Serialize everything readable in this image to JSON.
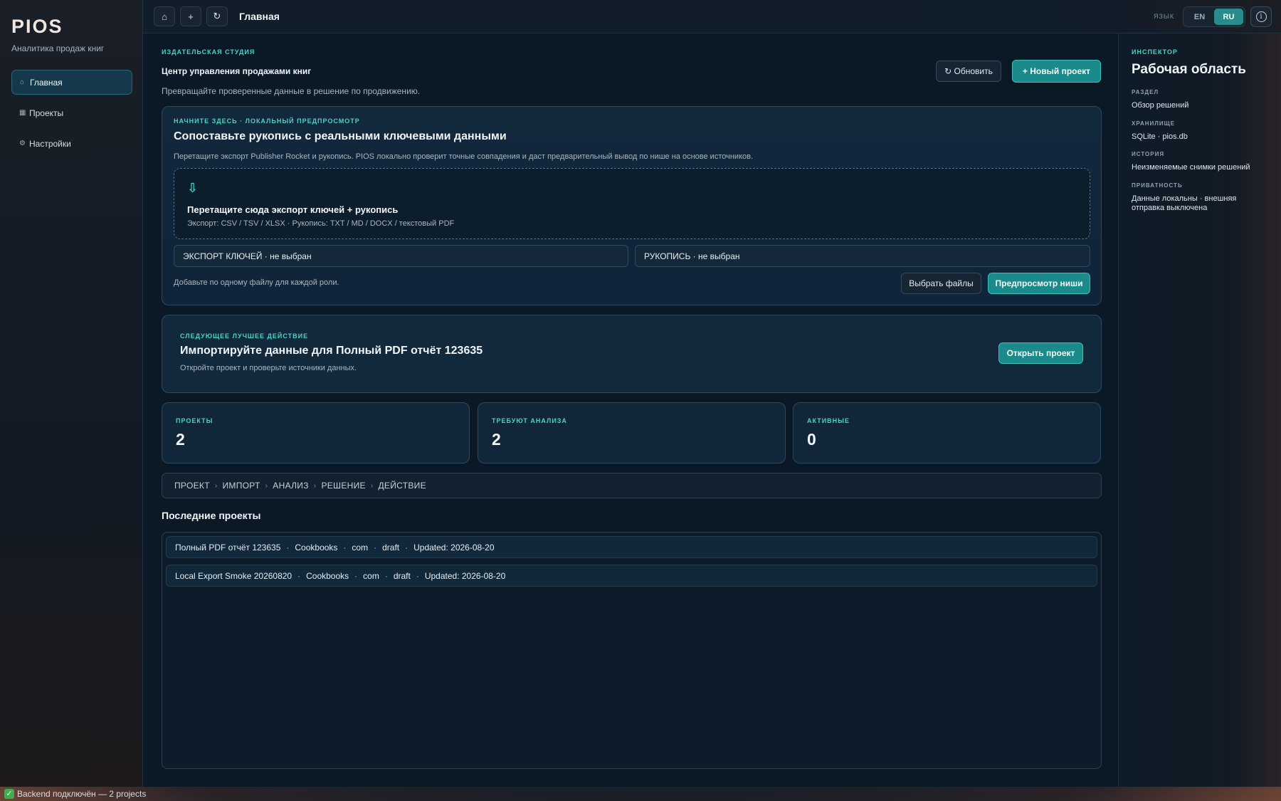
{
  "app": {
    "brand": "PIOS",
    "subtitle": "Аналитика продаж книг"
  },
  "sidebar": {
    "items": [
      {
        "icon": "home-icon",
        "glyph": "⌂",
        "label": "Главная",
        "active": true
      },
      {
        "icon": "projects-icon",
        "glyph": "▦",
        "label": "Проекты",
        "active": false
      },
      {
        "icon": "settings-icon",
        "glyph": "⚙",
        "label": "Настройки",
        "active": false
      }
    ]
  },
  "topbar": {
    "title": "Главная",
    "lang_label": "ЯЗЫК",
    "lang_options": [
      "EN",
      "RU"
    ],
    "lang_selected": "RU"
  },
  "header": {
    "eyebrow": "ИЗДАТЕЛЬСКАЯ СТУДИЯ",
    "title": "Центр управления продажами книг",
    "subtitle": "Превращайте проверенные данные в решение по продвижению.",
    "refresh_label": "↻  Обновить",
    "new_project_label": "+   Новый проект"
  },
  "upload": {
    "eyebrow": "НАЧНИТЕ ЗДЕСЬ · ЛОКАЛЬНЫЙ ПРЕДПРОСМОТР",
    "title": "Сопоставьте рукопись с реальными ключевыми данными",
    "description": "Перетащите экспорт Publisher Rocket и рукопись. PIOS локально проверит точные совпадения и даст предварительный вывод по нише на основе источников.",
    "dropzone_title": "Перетащите сюда экспорт ключей + рукопись",
    "dropzone_hint": "Экспорт: CSV / TSV / XLSX · Рукопись: TXT / MD / DOCX / текстовый PDF",
    "export_field": "ЭКСПОРТ КЛЮЧЕЙ · не выбран",
    "manuscript_field": "РУКОПИСЬ · не выбран",
    "helper": "Добавьте по одному файлу для каждой роли.",
    "choose_files_label": "Выбрать файлы",
    "preview_label": "Предпросмотр ниши"
  },
  "next_action": {
    "eyebrow": "СЛЕДУЮЩЕЕ ЛУЧШЕЕ ДЕЙСТВИЕ",
    "title": "Импортируйте данные для Полный PDF отчёт 123635",
    "description": "Откройте проект и проверьте источники данных.",
    "button_label": "Открыть проект"
  },
  "stats": [
    {
      "label": "ПРОЕКТЫ",
      "value": "2"
    },
    {
      "label": "ТРЕБУЮТ АНАЛИЗА",
      "value": "2"
    },
    {
      "label": "АКТИВНЫЕ",
      "value": "0"
    }
  ],
  "pipeline": [
    "ПРОЕКТ",
    "ИМПОРТ",
    "АНАЛИЗ",
    "РЕШЕНИЕ",
    "ДЕЙСТВИЕ"
  ],
  "recent": {
    "title": "Последние проекты",
    "rows": [
      {
        "name": "Полный PDF отчёт 123635",
        "category": "Cookbooks",
        "market": "com",
        "status": "draft",
        "updated": "Updated: 2026-08-20"
      },
      {
        "name": "Local Export Smoke 20260820",
        "category": "Cookbooks",
        "market": "com",
        "status": "draft",
        "updated": "Updated: 2026-08-20"
      }
    ]
  },
  "inspector": {
    "eyebrow": "ИНСПЕКТОР",
    "title": "Рабочая область",
    "fields": [
      {
        "label": "РАЗДЕЛ",
        "value": "Обзор решений"
      },
      {
        "label": "ХРАНИЛИЩЕ",
        "value": "SQLite · pios.db"
      },
      {
        "label": "ИСТОРИЯ",
        "value": "Неизменяемые снимки решений"
      },
      {
        "label": "ПРИВАТНОСТЬ",
        "value": "Данные локальны · внешняя отправка выключена"
      }
    ]
  },
  "statusbar": {
    "text": "Backend подключён — 2 projects"
  },
  "colors": {
    "accent": "#4fd1c5",
    "primary_button": "#1a8a8a",
    "background": "#0b1926"
  }
}
